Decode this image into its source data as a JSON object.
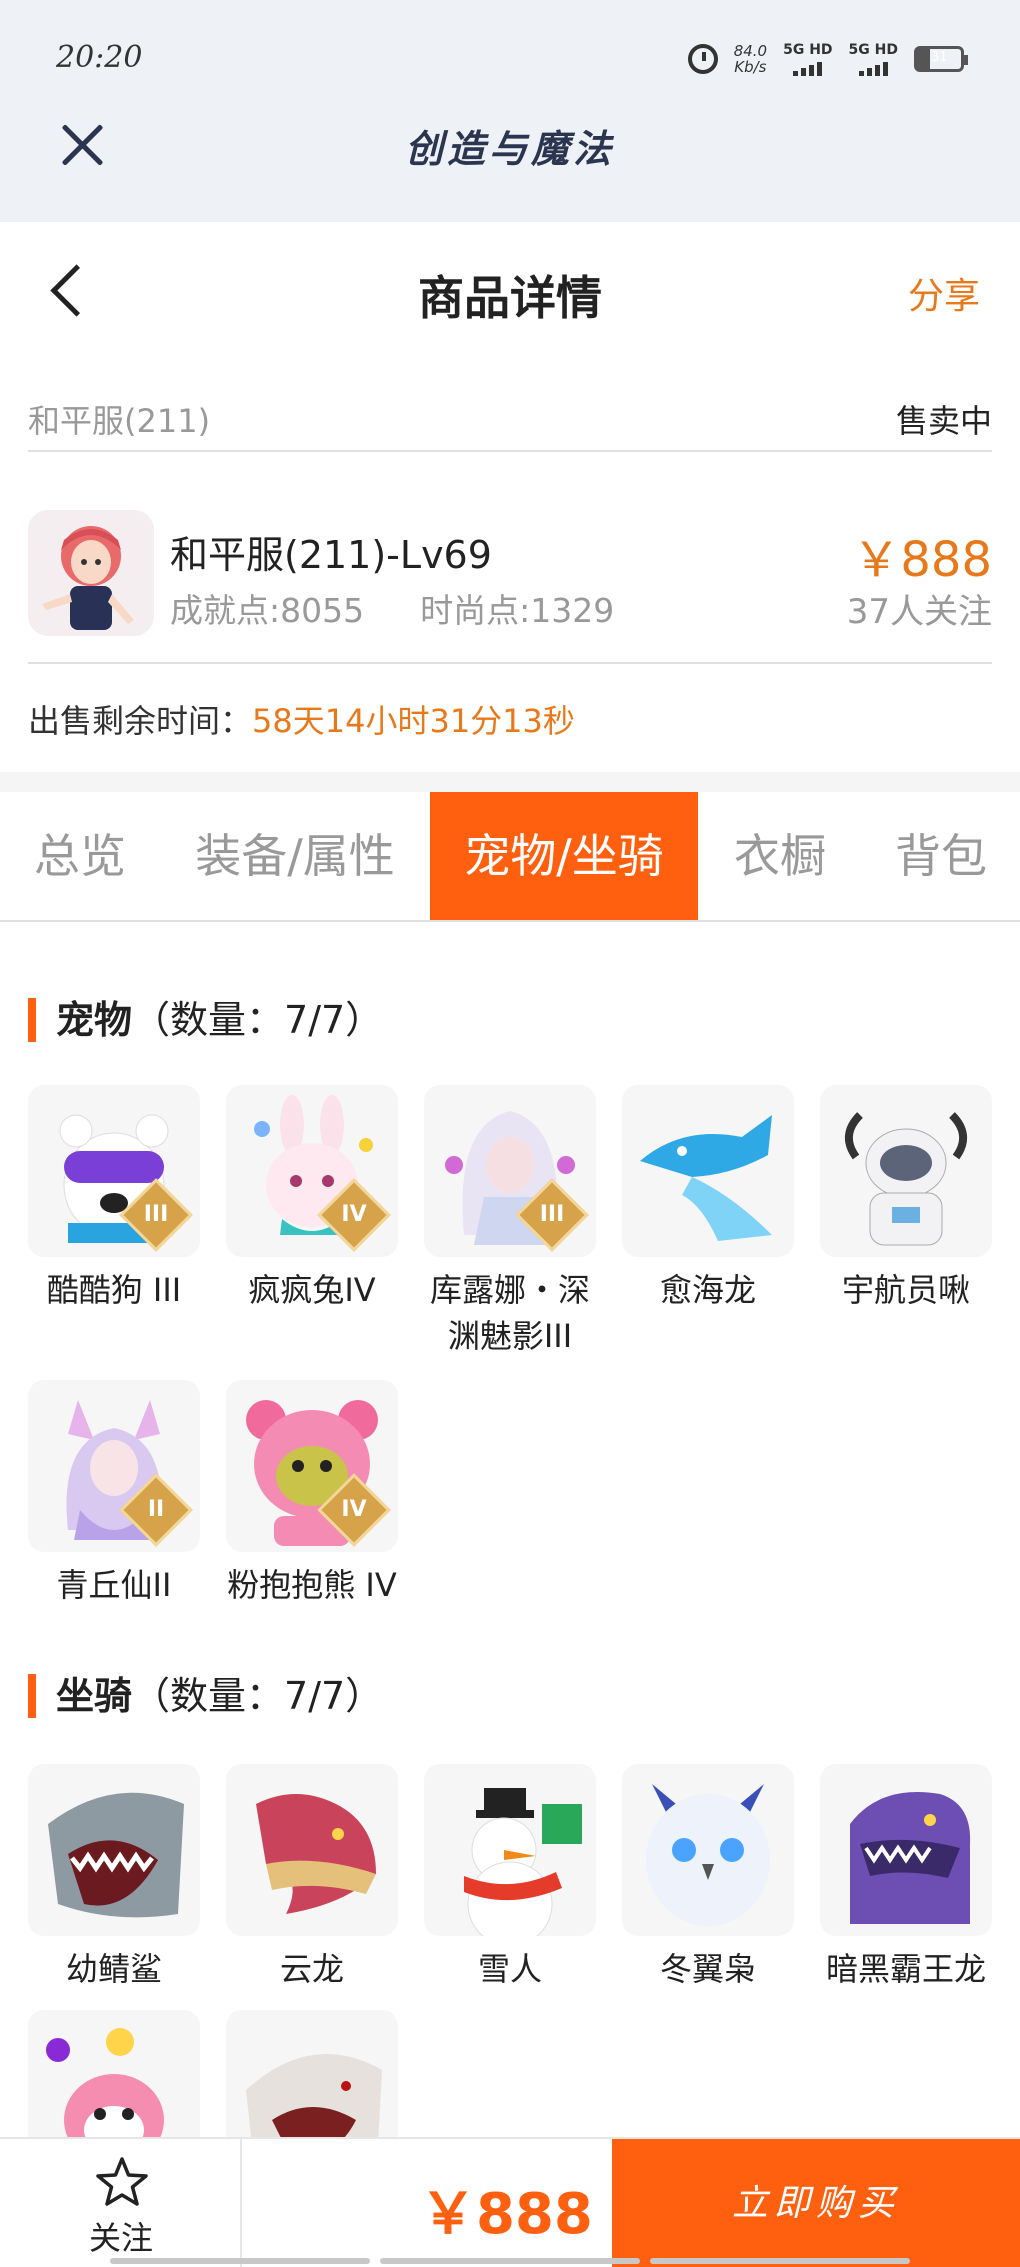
{
  "status_bar": {
    "time": "20:20",
    "net_speed": "84.0",
    "net_unit": "Kb/s",
    "sim1": "5G HD",
    "sim2": "5G HD",
    "battery": "31"
  },
  "app_bar": {
    "title": "创造与魔法"
  },
  "header": {
    "title": "商品详情",
    "share": "分享"
  },
  "listing": {
    "server": "和平服(211)",
    "status": "售卖中",
    "name": "和平服(211)-Lv69",
    "achievement": "成就点:8055",
    "fashion": "时尚点:1329",
    "price": "￥888",
    "followers": "37人关注",
    "countdown_label": "出售剩余时间：",
    "countdown_value": "58天14小时31分13秒"
  },
  "tabs": [
    {
      "label": "总览",
      "active": false
    },
    {
      "label": "装备/属性",
      "active": false
    },
    {
      "label": "宠物/坐骑",
      "active": true
    },
    {
      "label": "衣橱",
      "active": false
    },
    {
      "label": "背包",
      "active": false
    }
  ],
  "pets": {
    "title": "宠物",
    "count": "（数量：7/7）",
    "items": [
      {
        "name": "酷酷狗 III",
        "rank": "III",
        "icon": "bear-goggles-icon"
      },
      {
        "name": "疯疯兔IV",
        "rank": "IV",
        "icon": "rabbit-icon"
      },
      {
        "name": "库露娜・深渊魅影III",
        "rank": "III",
        "icon": "fairy-girl-icon"
      },
      {
        "name": "愈海龙",
        "rank": "",
        "icon": "sea-dragon-icon"
      },
      {
        "name": "宇航员啾",
        "rank": "",
        "icon": "astronaut-icon"
      },
      {
        "name": "青丘仙II",
        "rank": "II",
        "icon": "fox-spirit-icon"
      },
      {
        "name": "粉抱抱熊 IV",
        "rank": "IV",
        "icon": "pink-bear-icon"
      }
    ]
  },
  "mounts": {
    "title": "坐骑",
    "count": "（数量：7/7）",
    "items": [
      {
        "name": "幼鲭鲨",
        "icon": "shark-icon"
      },
      {
        "name": "云龙",
        "icon": "cloud-dragon-icon"
      },
      {
        "name": "雪人",
        "icon": "snowman-icon"
      },
      {
        "name": "冬翼枭",
        "icon": "owl-icon"
      },
      {
        "name": "暗黑霸王龙",
        "icon": "trex-icon"
      },
      {
        "name": "",
        "icon": "pink-fox-icon"
      },
      {
        "name": "",
        "icon": "white-shark-icon"
      }
    ]
  },
  "bottom_bar": {
    "follow": "关注",
    "price": "￥888",
    "buy": "立即购买"
  },
  "colors": {
    "accent": "#ff6010",
    "price": "#e8791a",
    "appbar_bg": "#eef2f6"
  }
}
